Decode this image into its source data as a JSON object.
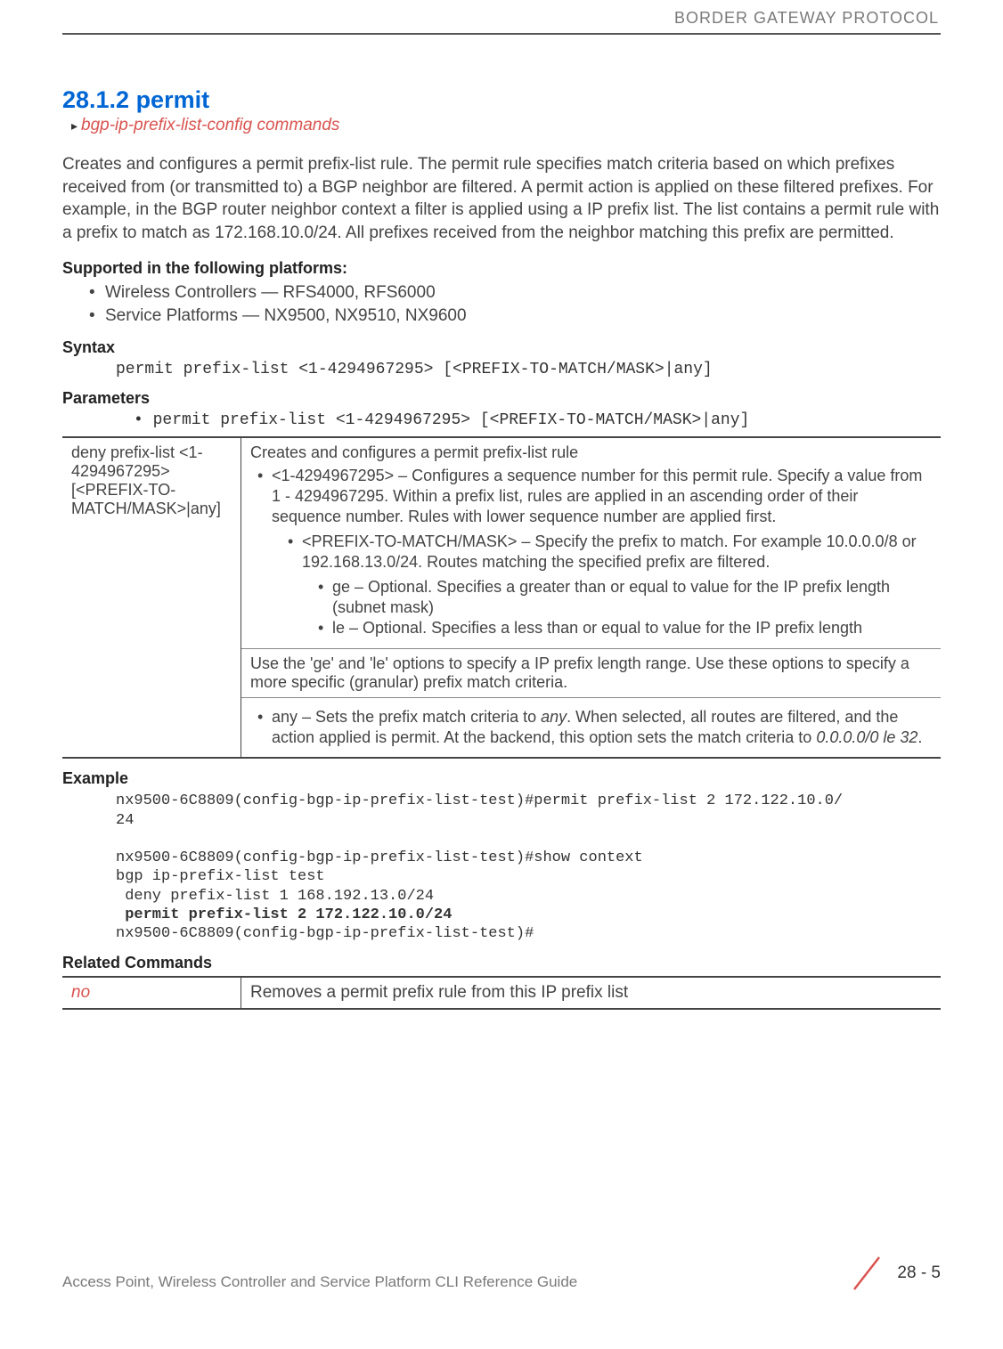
{
  "header": {
    "running_head": "BORDER GATEWAY PROTOCOL"
  },
  "section": {
    "number_title": "28.1.2 permit",
    "breadcrumb": "bgp-ip-prefix-list-config commands",
    "intro": "Creates and configures a permit prefix-list rule. The permit rule specifies match criteria based on which prefixes received from (or transmitted to) a BGP neighbor are filtered. A permit action is applied on these filtered prefixes. For example, in the BGP router neighbor context a filter is applied using a IP prefix list. The list contains a permit rule with a prefix to match as 172.168.10.0/24. All prefixes received from the neighbor matching this prefix are permitted."
  },
  "supported": {
    "heading": "Supported in the following platforms:",
    "items": [
      "Wireless Controllers — RFS4000, RFS6000",
      "Service Platforms — NX9500, NX9510, NX9600"
    ]
  },
  "syntax": {
    "heading": "Syntax",
    "line": "permit prefix-list <1-4294967295> [<PREFIX-TO-MATCH/MASK>|any]"
  },
  "parameters": {
    "heading": "Parameters",
    "line": "• permit prefix-list <1-4294967295> [<PREFIX-TO-MATCH/MASK>|any]",
    "left": "deny prefix-list <1-4294967295> [<PREFIX-TO-MATCH/MASK>|any]",
    "right_intro": "Creates and configures a permit prefix-list rule",
    "b1": "<1-4294967295> – Configures a sequence number for this permit rule. Specify a value from 1 - 4294967295. Within a prefix list, rules are applied in an ascending order of their sequence number. Rules with lower sequence number are applied first.",
    "b1a": "<PREFIX-TO-MATCH/MASK> – Specify the prefix to match. For example 10.0.0.0/8 or 192.168.13.0/24. Routes matching the specified prefix are filtered.",
    "b1a1": "ge – Optional. Specifies a greater than or equal to value for the IP prefix length (subnet mask)",
    "b1a2": "le – Optional. Specifies a less than or equal to value for the IP prefix length",
    "use_note": "Use the 'ge' and 'le' options to specify a IP prefix length range. Use these options to specify a more specific (granular) prefix match criteria.",
    "any_pre": "any – Sets the prefix match criteria to ",
    "any_ital": "any",
    "any_post": ". When selected, all routes are filtered, and the action applied is permit. At the backend, this option sets the match criteria to ",
    "any_ital2": "0.0.0.0/0 le 32",
    "any_end": "."
  },
  "example": {
    "heading": "Example",
    "l1": "nx9500-6C8809(config-bgp-ip-prefix-list-test)#permit prefix-list 2 172.122.10.0/",
    "l2": "24",
    "l3": "",
    "l4": "nx9500-6C8809(config-bgp-ip-prefix-list-test)#show context",
    "l5": "bgp ip-prefix-list test",
    "l6": " deny prefix-list 1 168.192.13.0/24",
    "l7": " permit prefix-list 2 172.122.10.0/24",
    "l8": "nx9500-6C8809(config-bgp-ip-prefix-list-test)#"
  },
  "related": {
    "heading": "Related Commands",
    "cmd": "no",
    "desc": "Removes a permit prefix rule from this IP prefix list"
  },
  "footer": {
    "left": "Access Point, Wireless Controller and Service Platform CLI Reference Guide",
    "page": "28 - 5"
  }
}
